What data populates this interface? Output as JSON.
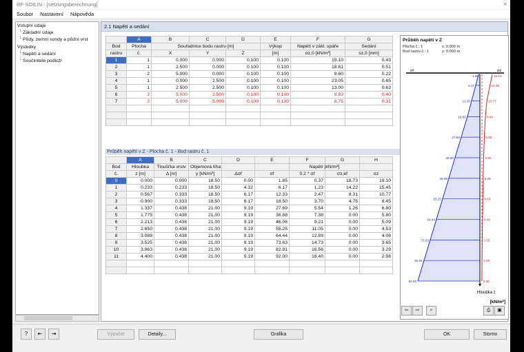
{
  "window": {
    "title": "RF-SOILIN - [setzungsberechnung]"
  },
  "menu": [
    "Soubor",
    "Nastavení",
    "Nápověda"
  ],
  "nav": {
    "items": [
      {
        "label": "Vstupní údaje"
      },
      {
        "label": "Základní údaje"
      },
      {
        "label": "Půdy, zemní sondy a půdní vrst"
      },
      {
        "label": "Výsledky"
      },
      {
        "label": "Napětí a sedání"
      },
      {
        "label": "Součinitele podloží"
      }
    ]
  },
  "section": {
    "title": "2.1 Napětí a sedání"
  },
  "table1": {
    "letters": [
      "A",
      "B",
      "C",
      "D",
      "E",
      "F",
      "G"
    ],
    "rowhdr": [
      "Bod",
      "rastru"
    ],
    "h1": [
      "Plocha",
      "Souřadnice bodu rastru [m]",
      "Výkop",
      "Napětí v zákl. spáře",
      "Sedání"
    ],
    "h2": [
      "č.",
      "X",
      "Y",
      "Z",
      "[m]",
      "σz,0 [kN/m²]",
      "sz,0 [mm]"
    ],
    "rows": [
      [
        "1",
        "1",
        "0.000",
        "0.000",
        "0.100",
        "0.100",
        "19.10",
        "0.43"
      ],
      [
        "2",
        "1",
        "2.500",
        "0.000",
        "0.100",
        "0.100",
        "18.61",
        "0.51"
      ],
      [
        "3",
        "2",
        "5.000",
        "0.000",
        "0.100",
        "0.100",
        "9.60",
        "0.22"
      ],
      [
        "4",
        "1",
        "0.000",
        "2.500",
        "0.100",
        "0.100",
        "23.05",
        "0.65"
      ],
      [
        "5",
        "1",
        "2.500",
        "2.500",
        "0.100",
        "0.100",
        "13.00",
        "0.63"
      ],
      [
        "6",
        "2",
        "5.000",
        "2.500",
        "0.100",
        "0.100",
        "9.83",
        "0.40"
      ],
      [
        "7",
        "2",
        "5.000",
        "5.000",
        "0.100",
        "0.100",
        "8.75",
        "0.31"
      ]
    ]
  },
  "sub": {
    "label": "Průběh napětí v Z  -  Plocha č. 1  -  Bod rastru č. 1"
  },
  "table2": {
    "letters": [
      "A",
      "B",
      "C",
      "D",
      "E",
      "F",
      "G",
      "H"
    ],
    "rowhdr": [
      "Bod",
      "č."
    ],
    "h1": [
      "Hloubka",
      "Tloušťka vrstv",
      "Objemová tíha",
      "Napětí [kN/m²]"
    ],
    "h2": [
      "z [m]",
      "Δ [m]",
      "γ [kN/m³]",
      "Δσf",
      "σf",
      "0.2 * σf",
      "σz,ef",
      "σz"
    ],
    "rows": [
      [
        "0",
        "0.000",
        "0.000",
        "18.50",
        "0.00",
        "1.85",
        "0.37",
        "18.73",
        "19.10"
      ],
      [
        "1",
        "0.233",
        "0.233",
        "18.50",
        "4.32",
        "6.17",
        "1.23",
        "14.22",
        "15.45"
      ],
      [
        "2",
        "0.567",
        "0.333",
        "18.50",
        "6.17",
        "12.33",
        "2.47",
        "8.31",
        "10.77"
      ],
      [
        "3",
        "0.900",
        "0.333",
        "18.50",
        "6.17",
        "18.50",
        "3.70",
        "4.75",
        "8.45"
      ],
      [
        "4",
        "1.337",
        "0.438",
        "21.00",
        "9.19",
        "27.69",
        "5.54",
        "1.26",
        "6.80"
      ],
      [
        "5",
        "1.775",
        "0.438",
        "21.00",
        "9.19",
        "36.88",
        "7.38",
        "0.00",
        "5.80"
      ],
      [
        "6",
        "2.213",
        "0.438",
        "21.00",
        "9.19",
        "46.06",
        "9.21",
        "0.00",
        "5.09"
      ],
      [
        "7",
        "2.650",
        "0.438",
        "21.00",
        "9.19",
        "55.25",
        "11.05",
        "0.00",
        "4.53"
      ],
      [
        "8",
        "3.088",
        "0.438",
        "21.00",
        "9.19",
        "64.44",
        "12.89",
        "0.00",
        "4.06"
      ],
      [
        "9",
        "3.525",
        "0.438",
        "21.00",
        "9.19",
        "73.63",
        "14.73",
        "0.00",
        "3.65"
      ],
      [
        "10",
        "3.963",
        "0.438",
        "21.00",
        "9.19",
        "82.81",
        "16.56",
        "0.00",
        "3.29"
      ],
      [
        "11",
        "4.400",
        "0.438",
        "21.00",
        "9.19",
        "92.00",
        "18.40",
        "0.00",
        "2.98"
      ]
    ]
  },
  "graph": {
    "title": "Průběh napětí v Z",
    "info1": "Plocha č.: 1",
    "info1b": "x: 0.000 m",
    "info2": "Bod rastru č.: 1",
    "info2b": "y: 0.000 m",
    "sigma_f_label": "σf",
    "sigma_z_label": "σz",
    "axis_label": "Hloubka z",
    "units": "[kN/m²]",
    "colors": {
      "blue": "#1f2fd1",
      "red": "#e02020",
      "fill": "#dfe3f7"
    }
  },
  "chart_data": {
    "type": "line",
    "xlabel": "",
    "ylabel": "Hloubka z",
    "units": "[kN/m²]",
    "x": [
      0.0,
      0.233,
      0.567,
      0.9,
      1.337,
      1.775,
      2.213,
      2.65,
      3.088,
      3.525,
      3.963,
      4.4
    ],
    "series": [
      {
        "name": "σf",
        "values": [
          1.85,
          6.17,
          12.33,
          18.5,
          27.69,
          36.88,
          46.06,
          55.25,
          64.44,
          73.63,
          82.81,
          92.0
        ]
      },
      {
        "name": "σz",
        "values": [
          19.1,
          15.45,
          10.77,
          8.45,
          6.8,
          5.8,
          5.09,
          4.53,
          4.06,
          3.65,
          3.29,
          2.98
        ]
      }
    ]
  },
  "buttons": {
    "vypocet": "Výpočet",
    "detaily": "Detaily...",
    "grafika": "Grafika",
    "ok": "OK",
    "storno": "Storno"
  }
}
